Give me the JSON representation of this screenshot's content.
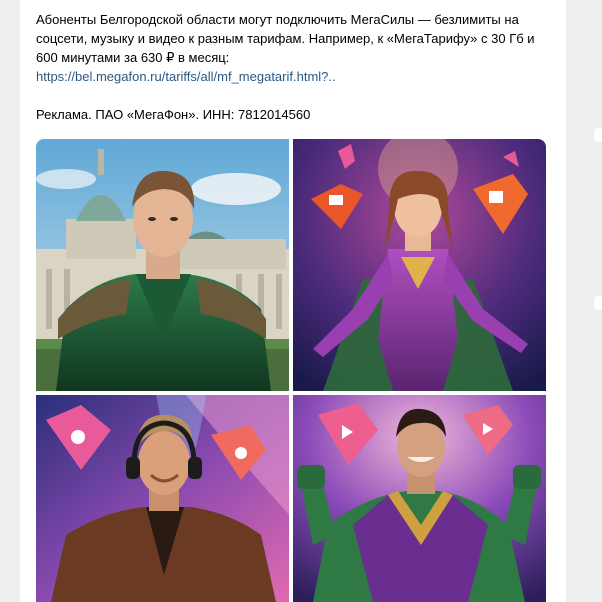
{
  "post": {
    "text_line_1": "Абоненты Белгородской области могут подключить МегаСилы — безлимиты на",
    "text_line_2": "соцсети, музыку и видео к разным тарифам. Например, к «МегаТарифу» с 30 Гб и",
    "text_line_3": "600 минутами за 630 ₽ в месяц:",
    "link": "https://bel.megafon.ru/tariffs/all/mf_megatarif.html?..",
    "ad_label": "Реклама. ПАО «МегаФон». ИНН: 7812014560"
  },
  "colors": {
    "page_bg": "#edeef0",
    "card_bg": "#ffffff",
    "link": "#2a5885",
    "text": "#000000"
  },
  "photos": [
    {
      "name": "photo-hero-green-armor",
      "subject": "man in green armor in front of domed building"
    },
    {
      "name": "photo-heroine-purple-suit",
      "subject": "woman in purple and gold suit with floating app icons"
    },
    {
      "name": "photo-man-headphones-music",
      "subject": "man in leather jacket with headphones and music note icons"
    },
    {
      "name": "photo-hero-green-purple-cape",
      "subject": "man in green and purple suit with video play icons"
    }
  ]
}
